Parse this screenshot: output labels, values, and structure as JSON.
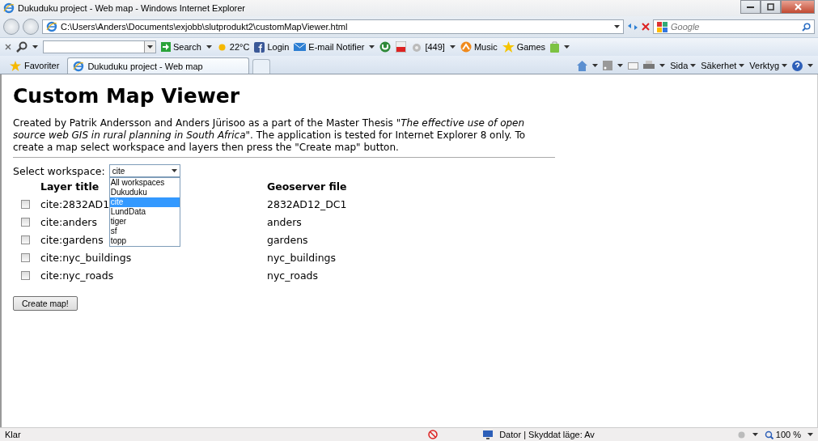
{
  "window": {
    "title": "Dukuduku project - Web map - Windows Internet Explorer"
  },
  "address_bar": {
    "url": "C:\\Users\\Anders\\Documents\\exjobb\\slutprodukt2\\customMapViewer.html",
    "search_placeholder": "Google"
  },
  "toolbar": {
    "items": [
      {
        "kind": "button",
        "label": "Search"
      },
      {
        "kind": "weather",
        "label": "22°C"
      },
      {
        "kind": "facebook",
        "label": "Login"
      },
      {
        "kind": "mail",
        "label": "E-mail Notifier"
      },
      {
        "kind": "torrent"
      },
      {
        "kind": "youtube"
      },
      {
        "kind": "counter",
        "label": "[449]"
      },
      {
        "kind": "music",
        "label": "Music"
      },
      {
        "kind": "games",
        "label": "Games"
      },
      {
        "kind": "bag"
      }
    ]
  },
  "favorites": {
    "label": "Favoriter"
  },
  "tabs": [
    {
      "label": "Dukuduku project - Web map",
      "selected": true
    }
  ],
  "command_bar": {
    "menus": [
      "Sida",
      "Säkerhet",
      "Verktyg"
    ]
  },
  "page": {
    "heading": "Custom Map Viewer",
    "intro": "Created by Patrik Andersson and Anders Jürisoo as a part of the Master Thesis \"*The effective use of open source web GIS in rural planning in South Africa*\". The application is tested for Internet Explorer 8 only. To create a map select workspace and layers then press the \"Create map\" button.",
    "workspace_label": "Select workspace:",
    "workspace_value": "cite",
    "workspace_options": [
      {
        "label": "All workspaces",
        "selected": false
      },
      {
        "label": "Dukuduku",
        "selected": false
      },
      {
        "label": "cite",
        "selected": true
      },
      {
        "label": "LundData",
        "selected": false
      },
      {
        "label": "tiger",
        "selected": false
      },
      {
        "label": "sf",
        "selected": false
      },
      {
        "label": "topp",
        "selected": false
      }
    ],
    "columns": [
      "Layer title",
      "Geoserver file"
    ],
    "layers": [
      {
        "title": "cite:2832AD1",
        "file": "2832AD12_DC1",
        "checked": false
      },
      {
        "title": "cite:anders",
        "file": "anders",
        "checked": false
      },
      {
        "title": "cite:gardens",
        "file": "gardens",
        "checked": false
      },
      {
        "title": "cite:nyc_buildings",
        "file": "nyc_buildings",
        "checked": false
      },
      {
        "title": "cite:nyc_roads",
        "file": "nyc_roads",
        "checked": false
      }
    ],
    "create_button": "Create map!"
  },
  "status_bar": {
    "status": "Klar",
    "zone": "Dator | Skyddat läge: Av",
    "zoom": "100 %"
  }
}
